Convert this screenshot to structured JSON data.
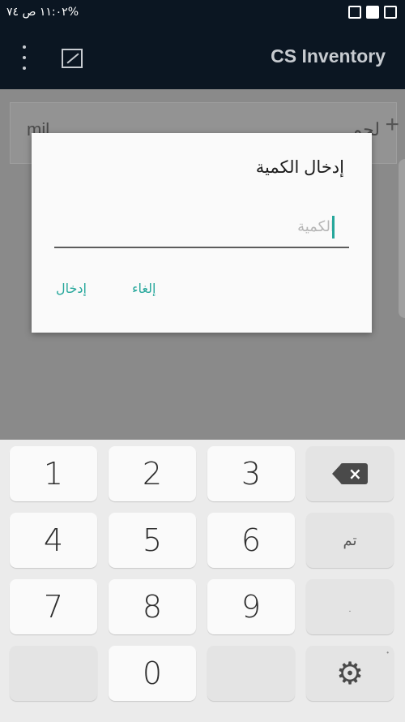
{
  "status_bar": {
    "time": "١١:٠٢ ص",
    "battery": "٧٤%"
  },
  "app_bar": {
    "title": "CS Inventory",
    "menu_icon": "more-vert-icon",
    "image_icon": "image-icon"
  },
  "background": {
    "left_text": "mil",
    "right_text": "لحم",
    "plus": "+"
  },
  "dialog": {
    "title": "إدخال الكمية",
    "input_placeholder": "الكمية",
    "input_value": "",
    "cancel_label": "إلغاء",
    "enter_label": "إدخال"
  },
  "keyboard": {
    "keys": [
      "1",
      "2",
      "3",
      "4",
      "5",
      "6",
      "7",
      "8",
      "9",
      "0"
    ],
    "done_label": "تم",
    "period_label": ".",
    "backspace_icon": "backspace-icon",
    "settings_icon": "gear-icon"
  }
}
